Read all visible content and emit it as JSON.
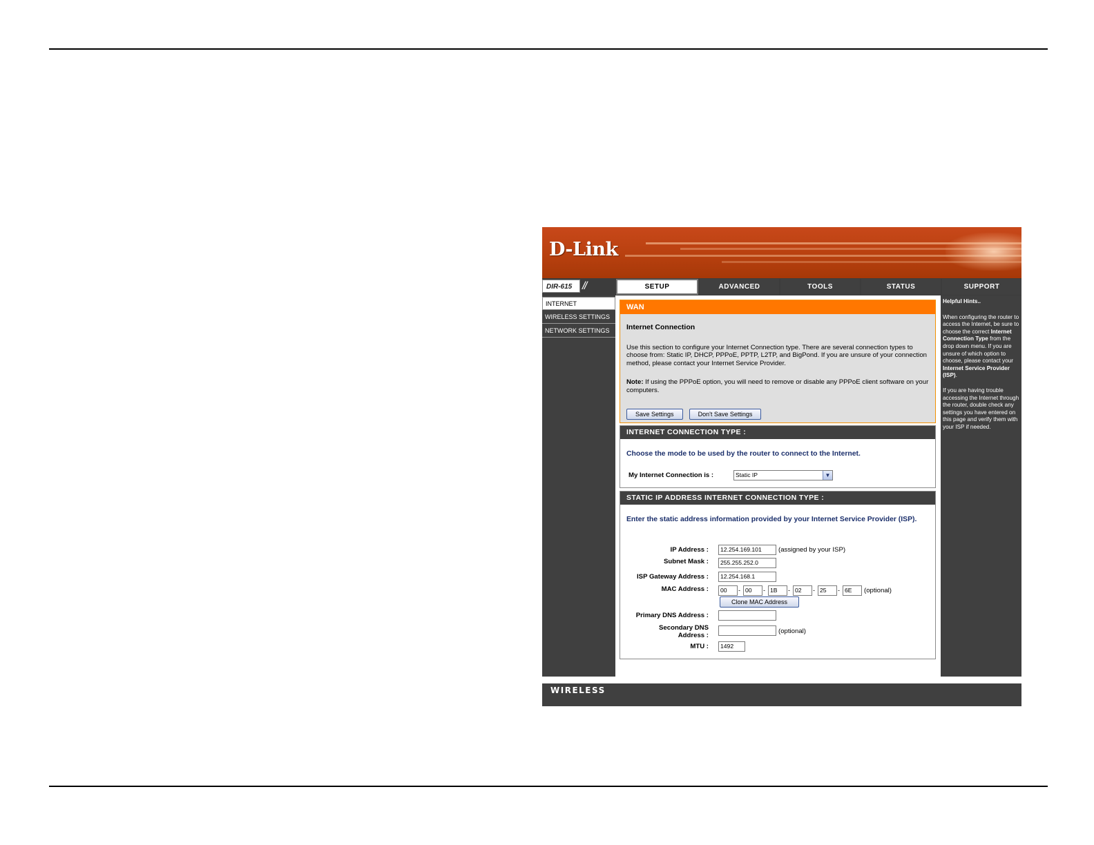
{
  "brand": {
    "logo_text": "D-Link",
    "model": "DIR-615",
    "footer_text": "WIRELESS"
  },
  "nav": {
    "tabs": [
      {
        "label": "SETUP",
        "active": true
      },
      {
        "label": "ADVANCED",
        "active": false
      },
      {
        "label": "TOOLS",
        "active": false
      },
      {
        "label": "STATUS",
        "active": false
      },
      {
        "label": "SUPPORT",
        "active": false
      }
    ]
  },
  "sidebar": {
    "items": [
      {
        "label": "INTERNET",
        "active": true
      },
      {
        "label": "WIRELESS SETTINGS",
        "active": false
      },
      {
        "label": "NETWORK SETTINGS",
        "active": false
      }
    ]
  },
  "wan": {
    "title": "WAN",
    "subtitle": "Internet Connection",
    "description": "Use this section to configure your Internet Connection type. There are several connection types to choose from: Static IP, DHCP, PPPoE, PPTP, L2TP, and BigPond. If you are unsure of your connection method, please contact your Internet Service Provider.",
    "note_label": "Note:",
    "note_text": " If using the PPPoE option, you will need to remove or disable any PPPoE client software on your computers.",
    "save_label": "Save Settings",
    "dont_save_label": "Don't Save Settings"
  },
  "connection_type": {
    "header": "INTERNET CONNECTION TYPE :",
    "prompt": "Choose the mode to be used by the router to connect to the Internet.",
    "label": "My Internet Connection is :",
    "selected": "Static IP"
  },
  "static_ip": {
    "header": "STATIC IP ADDRESS INTERNET CONNECTION TYPE :",
    "prompt": "Enter the static address information provided by your Internet Service Provider (ISP).",
    "ip_label": "IP Address :",
    "ip_value": "12.254.169.101",
    "ip_note": "(assigned by your ISP)",
    "mask_label": "Subnet Mask :",
    "mask_value": "255.255.252.0",
    "gateway_label": "ISP Gateway Address :",
    "gateway_value": "12.254.168.1",
    "mac_label": "MAC Address :",
    "mac_values": [
      "00",
      "00",
      "1B",
      "02",
      "25",
      "6E"
    ],
    "mac_separator": "-",
    "mac_note": "(optional)",
    "clone_label": "Clone MAC Address",
    "dns1_label": "Primary DNS Address :",
    "dns1_value": "",
    "dns2_label_1": "Secondary DNS",
    "dns2_label_2": "Address :",
    "dns2_value": "",
    "dns2_note": "(optional)",
    "mtu_label": "MTU :",
    "mtu_value": "1492"
  },
  "hints": {
    "title": "Helpful Hints..",
    "p1_a": "When configuring the router to access the Internet, be sure to choose the correct ",
    "p1_b": "Internet Connection Type",
    "p1_c": " from the drop down menu. If you are unsure of which option to choose, please contact your ",
    "p1_d": "Internet Service Provider (ISP)",
    "p1_e": ".",
    "p2": "If you are having trouble accessing the Internet through the router, double check any settings you have entered on this page and verify them with your ISP if needed."
  }
}
